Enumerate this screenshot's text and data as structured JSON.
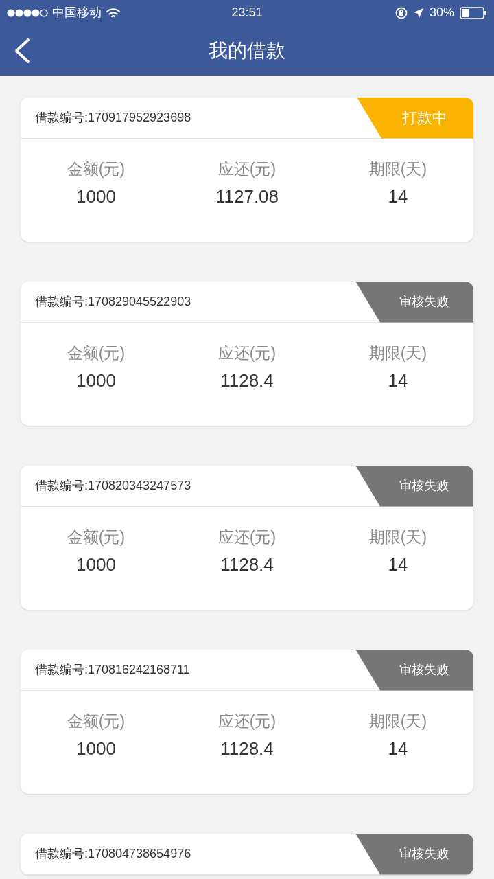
{
  "status_bar": {
    "carrier": "中国移动",
    "time": "23:51",
    "battery": "30%"
  },
  "nav": {
    "title": "我的借款"
  },
  "loans": [
    {
      "number": "借款编号:170917952923698",
      "status": {
        "kind": "processing",
        "label": "打款中"
      },
      "fields": [
        {
          "label": "金额(元)",
          "value": "1000"
        },
        {
          "label": "应还(元)",
          "value": "1127.08"
        },
        {
          "label": "期限(天)",
          "value": "14"
        }
      ]
    },
    {
      "number": "借款编号:170829045522903",
      "status": {
        "kind": "failed",
        "label": "审核失败"
      },
      "fields": [
        {
          "label": "金额(元)",
          "value": "1000"
        },
        {
          "label": "应还(元)",
          "value": "1128.4"
        },
        {
          "label": "期限(天)",
          "value": "14"
        }
      ]
    },
    {
      "number": "借款编号:170820343247573",
      "status": {
        "kind": "failed",
        "label": "审核失败"
      },
      "fields": [
        {
          "label": "金额(元)",
          "value": "1000"
        },
        {
          "label": "应还(元)",
          "value": "1128.4"
        },
        {
          "label": "期限(天)",
          "value": "14"
        }
      ]
    },
    {
      "number": "借款编号:170816242168711",
      "status": {
        "kind": "failed",
        "label": "审核失败"
      },
      "fields": [
        {
          "label": "金额(元)",
          "value": "1000"
        },
        {
          "label": "应还(元)",
          "value": "1128.4"
        },
        {
          "label": "期限(天)",
          "value": "14"
        }
      ]
    },
    {
      "number": "借款编号:170804738654976",
      "status": {
        "kind": "failed",
        "label": "审核失败"
      }
    }
  ]
}
